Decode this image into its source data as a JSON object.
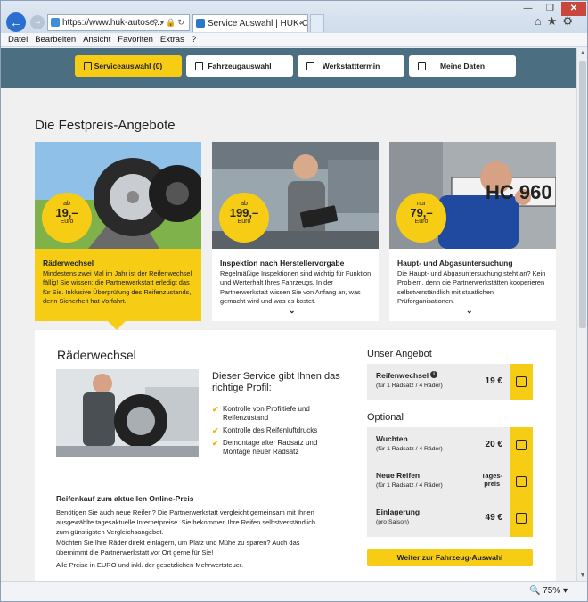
{
  "browser": {
    "address": "https://www.huk-autose...",
    "tab_title": "Service Auswahl | HUK-CO...",
    "tab_close": "×",
    "menu": [
      "Datei",
      "Bearbeiten",
      "Ansicht",
      "Favoriten",
      "Extras",
      "?"
    ],
    "zoom": "75%",
    "window_controls": {
      "min": "—",
      "max": "❐",
      "close": "✕"
    }
  },
  "steps": [
    {
      "label": "Serviceauswahl (0)",
      "active": true
    },
    {
      "label": "Fahrzeugauswahl",
      "active": false
    },
    {
      "label": "Werkstatttermin",
      "active": false
    },
    {
      "label": "Meine Daten",
      "active": false
    }
  ],
  "section_title": "Die Festpreis-Angebote",
  "cards": [
    {
      "badge_prefix": "ab",
      "price": "19,–",
      "currency": "Euro",
      "title": "Räderwechsel",
      "text": "Mindestens zwei Mal im Jahr ist der Reifenwechsel fällig! Sie wissen: die Partnerwerkstatt erledigt das für Sie. Inklusive Überprüfung des Reifenzustands, denn Sicherheit hat Vorfahrt.",
      "active": true
    },
    {
      "badge_prefix": "ab",
      "price": "199,–",
      "currency": "Euro",
      "title": "Inspektion nach Herstellervorgabe",
      "text": "Regelmäßige Inspektionen sind wichtig für Funktion und Werterhalt Ihres Fahrzeugs. In der Partnerwerkstatt wissen Sie von Anfang an, was gemacht wird und was es kostet.",
      "chevron": "⌄",
      "active": false
    },
    {
      "badge_prefix": "nur",
      "price": "79,–",
      "currency": "Euro",
      "title": "Haupt- und Abgasuntersuchung",
      "text": "Die Haupt- und Abgasuntersuchung steht an? Kein Problem, denn die Partnerwerkstätten kooperieren selbstverständlich mit staatlichen Prüforganisationen.",
      "chevron": "⌄",
      "plate": "HC 960",
      "active": false
    }
  ],
  "detail": {
    "title": "Räderwechsel",
    "profile_heading": "Dieser Service gibt Ihnen das richtige Profil:",
    "features": [
      "Kontrolle von Profiltiefe und Reifenzustand",
      "Kontrolle des Reifenluftdrucks",
      "Demontage alter Radsatz und Montage neuer Radsatz"
    ],
    "subheading": "Reifenkauf zum aktuellen Online-Preis",
    "paragraphs": [
      "Benötigen Sie auch neue Reifen? Die Partnerwerkstatt vergleicht gemeinsam mit Ihnen ausgewählte tagesaktuelle Internetpreise. Sie bekommen Ihre Reifen selbstverständlich zum günstigsten Vergleichsangebot.",
      "Möchten Sie Ihre Räder direkt einlagern, um Platz und Mühe zu sparen? Auch das übernimmt die Partnerwerkstatt vor Ort gerne für Sie!",
      "Alle Preise in EURO und inkl. der gesetzlichen Mehrwertsteuer."
    ],
    "offer_heading": "Unser Angebot",
    "main_offer": {
      "name": "Reifenwechsel",
      "sub": "(für 1 Radsatz / 4 Räder)",
      "price": "19 €"
    },
    "optional_heading": "Optional",
    "optional": [
      {
        "name": "Wuchten",
        "sub": "(für 1 Radsatz / 4 Räder)",
        "price": "20 €"
      },
      {
        "name": "Neue Reifen",
        "sub": "(für 1 Radsatz / 4 Räder)",
        "price": "Tages-\npreis"
      },
      {
        "name": "Einlagerung",
        "sub": "(pro Saison)",
        "price": "49 €"
      }
    ],
    "cta": "Weiter zur Fahrzeug-Auswahl"
  },
  "colors": {
    "accent": "#f7cc14",
    "steps_bar": "#4b6f80",
    "page_bg": "#f0f0f0"
  }
}
